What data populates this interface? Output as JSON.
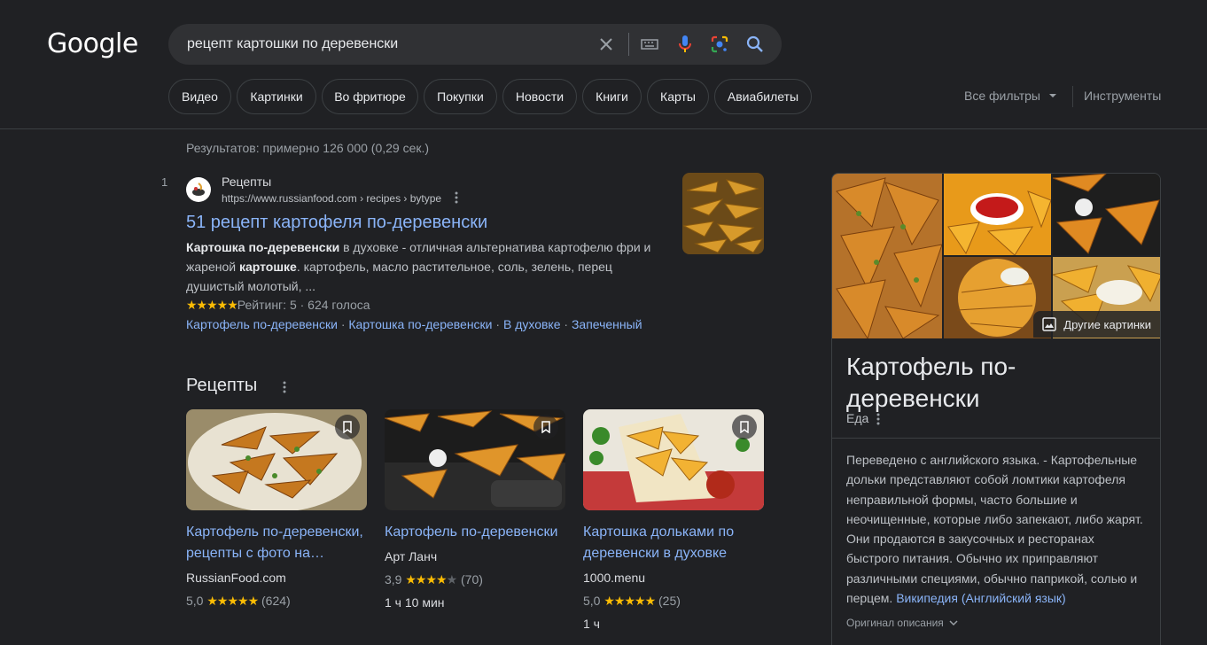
{
  "header": {
    "logo": "Google",
    "search_query": "рецепт картошки по деревенски"
  },
  "chips": [
    "Видео",
    "Картинки",
    "Во фритюре",
    "Покупки",
    "Новости",
    "Книги",
    "Карты",
    "Авиабилеты"
  ],
  "filters": {
    "all_filters": "Все фильтры",
    "tools": "Инструменты"
  },
  "results_count": "Результатов: примерно 126 000 (0,29 сек.)",
  "result": {
    "number": "1",
    "site_name": "Рецепты",
    "url": "https://www.russianfood.com › recipes › bytype",
    "title": "51 рецепт картофеля по-деревенски",
    "snippet": {
      "b1": "Картошка по-деревенски",
      "t1": " в духовке - отличная альтернатива картофелю фри и жареной ",
      "b2": "картошке",
      "t2": ". картофель, масло растительное, соль, зелень, перец душистый молотый, ..."
    },
    "stars": "★★★★★",
    "rating_text": "Рейтинг: 5 · 624 голоса",
    "sitelinks": [
      "Картофель по-деревенски",
      "Картошка по-деревенски",
      "В духовке",
      "Запеченный"
    ],
    "sitelink_sep": "·"
  },
  "recipes": {
    "heading": "Рецепты",
    "cards": [
      {
        "title": "Картофель по-деревенски, рецепты с фото на…",
        "source": "RussianFood.com",
        "rating": "5,0",
        "stars": "★★★★★",
        "votes": "(624)",
        "time": ""
      },
      {
        "title": "Картофель по-деревенски",
        "source": "Арт Ланч",
        "rating": "3,9",
        "stars": "★★★★",
        "star_empty": "★",
        "votes": "(70)",
        "time": "1 ч 10 мин"
      },
      {
        "title": "Картошка дольками по деревенски в духовке",
        "source": "1000.menu",
        "rating": "5,0",
        "stars": "★★★★★",
        "votes": "(25)",
        "time": "1 ч"
      }
    ]
  },
  "knowledge_panel": {
    "more_images": "Другие картинки",
    "title": "Картофель по-деревенски",
    "type": "Еда",
    "description": "Переведено с английского языка. - Картофельные дольки представляют собой ломтики картофеля неправильной формы, часто большие и неочищенные, которые либо запекают, либо жарят. Они продаются в закусочных и ресторанах быстрого питания. Обычно их приправляют различными специями, обычно паприкой, солью и перцем.",
    "wiki_link": "Википедия (Английский язык)",
    "original": "Оригинал описания"
  },
  "colors": {
    "background": "#202124",
    "link": "#8ab4f8",
    "star": "#fbbc04"
  }
}
